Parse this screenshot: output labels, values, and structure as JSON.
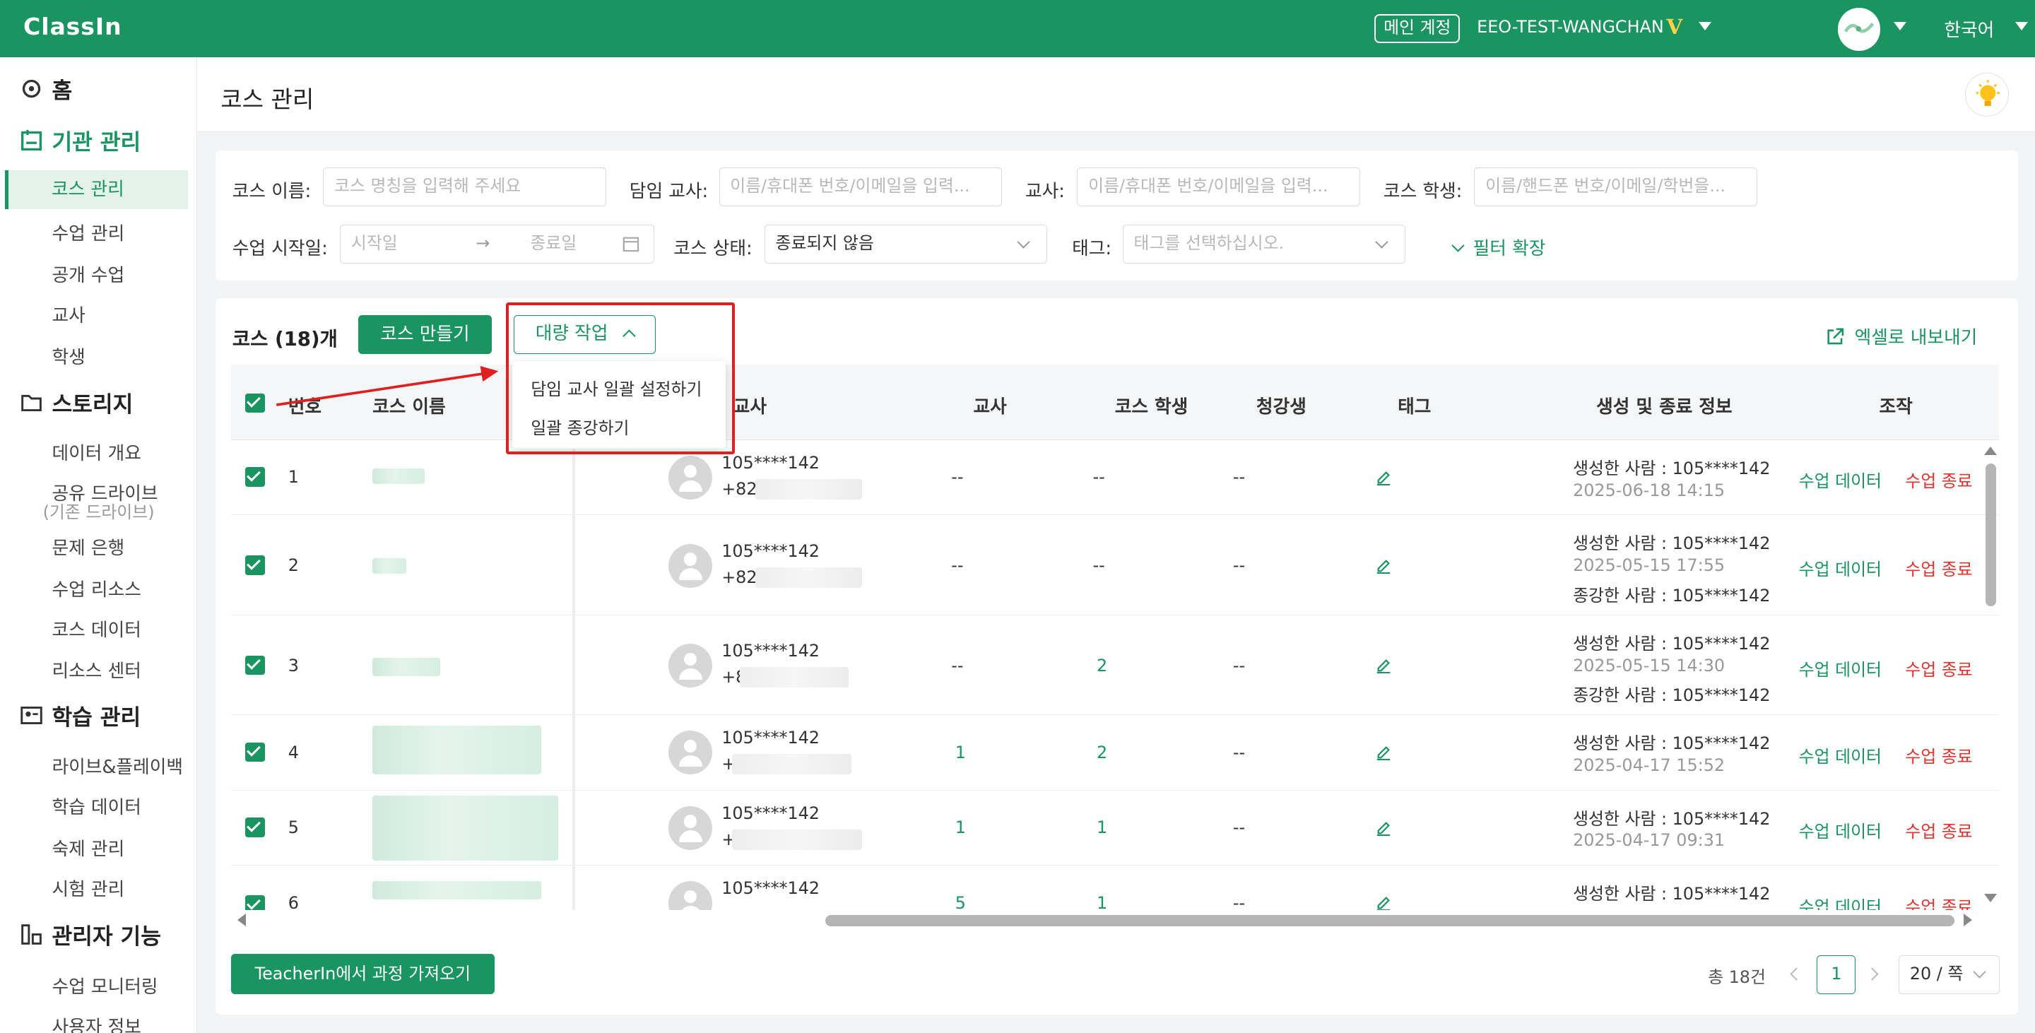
{
  "colors": {
    "brand": "#1a9461",
    "danger": "#e5322d",
    "annotation": "#e02020"
  },
  "topbar": {
    "logo": "ClassIn",
    "account_badge": "메인 계정",
    "account_name": "EEO-TEST-WANGCHAN",
    "vip_mark": "V",
    "language": "한국어"
  },
  "sidebar": {
    "home": "홈",
    "org_manage": "기관 관리",
    "org_items": [
      "코스 관리",
      "수업 관리",
      "공개 수업",
      "교사",
      "학생"
    ],
    "storage": "스토리지",
    "storage_items": [
      "데이터 개요",
      "공유 드라이브",
      "문제 은행",
      "수업 리소스",
      "코스 데이터",
      "리소스 센터"
    ],
    "storage_sub": "(기존 드라이브)",
    "learning": "학습 관리",
    "learning_items": [
      "라이브&플레이백",
      "학습 데이터",
      "숙제 관리",
      "시험 관리"
    ],
    "admin": "관리자 기능",
    "admin_items": [
      "수업 모니터링",
      "사용자 정보"
    ]
  },
  "page": {
    "title": "코스 관리"
  },
  "filters": {
    "course_name_label": "코스 이름:",
    "course_name_placeholder": "코스 명칭을 입력해 주세요",
    "homeroom_label": "담임 교사:",
    "homeroom_placeholder": "이름/휴대폰 번호/이메일을 입력...",
    "teacher_label": "교사:",
    "teacher_placeholder": "이름/휴대폰 번호/이메일을 입력...",
    "student_label": "코스 학생:",
    "student_placeholder": "이름/핸드폰 번호/이메일/학번을...",
    "start_label": "수업 시작일:",
    "start_from_placeholder": "시작일",
    "start_to_placeholder": "종료일",
    "range_sep": "→",
    "status_label": "코스 상태:",
    "status_value": "종료되지 않음",
    "tag_label": "태그:",
    "tag_placeholder": "태그를 선택하십시오.",
    "expand": "필터 확장"
  },
  "toolbar": {
    "count": "코스 (18)개",
    "create": "코스 만들기",
    "bulk": "대량 작업",
    "export": "엑셀로 내보내기"
  },
  "dropdown": {
    "items": [
      "담임 교사 일괄 설정하기",
      "일괄 종강하기"
    ]
  },
  "table": {
    "headers": {
      "no": "번호",
      "name": "코스 이름",
      "homeroom": "교사",
      "teacher": "교사",
      "students": "코스 학생",
      "auditors": "청강생",
      "tag": "태그",
      "info": "생성 및 종료 정보",
      "actions": "조작"
    },
    "rows": [
      {
        "no": "1",
        "hr_id": "105****142",
        "hr_phone": "+82",
        "teacher": "--",
        "students": "--",
        "auditors": "--",
        "created": "생성한 사람 : 105****142",
        "date": "2025-06-18 14:15",
        "closed": "",
        "act1": "수업 데이터",
        "act2": "수업 종료"
      },
      {
        "no": "2",
        "hr_id": "105****142",
        "hr_phone": "+82",
        "teacher": "--",
        "students": "--",
        "auditors": "--",
        "created": "생성한 사람 : 105****142",
        "date": "2025-05-15 17:55",
        "closed": "종강한 사람 : 105****142",
        "act1": "수업 데이터",
        "act2": "수업 종료"
      },
      {
        "no": "3",
        "hr_id": "105****142",
        "hr_phone": "+8",
        "teacher": "--",
        "students": "2",
        "auditors": "--",
        "created": "생성한 사람 : 105****142",
        "date": "2025-05-15 14:30",
        "closed": "종강한 사람 : 105****142",
        "act1": "수업 데이터",
        "act2": "수업 종료"
      },
      {
        "no": "4",
        "hr_id": "105****142",
        "hr_phone": "+",
        "teacher": "1",
        "students": "2",
        "auditors": "--",
        "created": "생성한 사람 : 105****142",
        "date": "2025-04-17 15:52",
        "closed": "",
        "act1": "수업 데이터",
        "act2": "수업 종료"
      },
      {
        "no": "5",
        "hr_id": "105****142",
        "hr_phone": "+",
        "teacher": "1",
        "students": "1",
        "auditors": "--",
        "created": "생성한 사람 : 105****142",
        "date": "2025-04-17 09:31",
        "closed": "",
        "act1": "수업 데이터",
        "act2": "수업 종료"
      },
      {
        "no": "6",
        "hr_id": "105****142",
        "hr_phone": "",
        "teacher": "5",
        "students": "1",
        "auditors": "--",
        "created": "생성한 사람 : 105****142",
        "date": "",
        "closed": "",
        "act1": "수업 데이터",
        "act2": "수업 종료"
      }
    ]
  },
  "footer": {
    "import": "TeacherIn에서 과정 가져오기",
    "total": "총 18건",
    "page": "1",
    "page_size": "20 / 쪽"
  }
}
